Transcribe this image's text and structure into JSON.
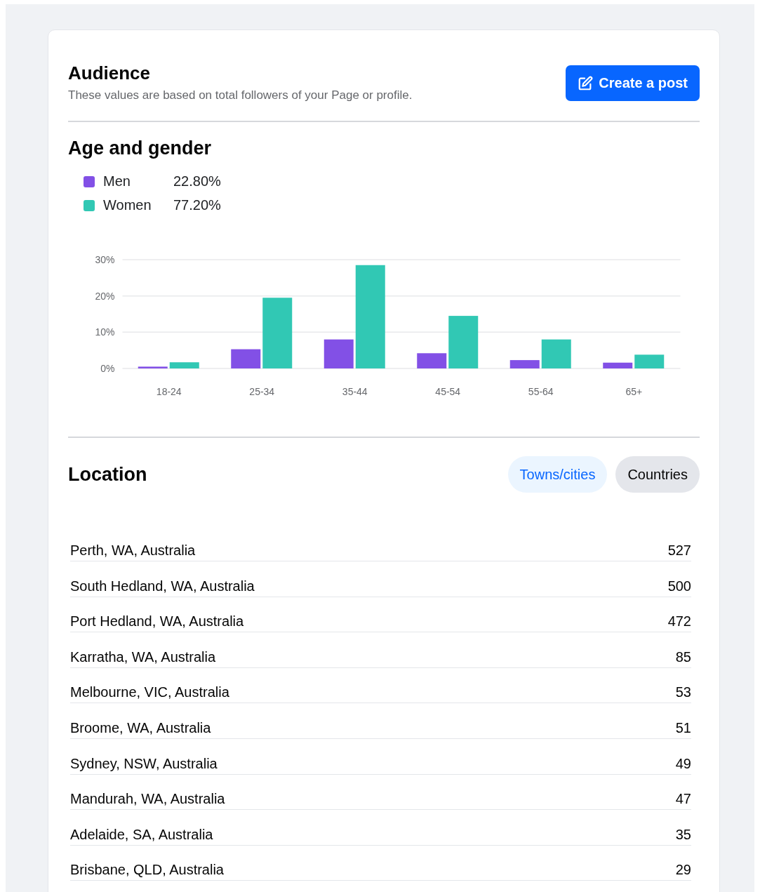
{
  "header": {
    "title": "Audience",
    "subtitle": "These values are based on total followers of your Page or profile.",
    "button": "Create a post"
  },
  "age_gender": {
    "title": "Age and gender",
    "legend_values": [
      "22.80%",
      "77.20%"
    ],
    "chart_data": {
      "type": "bar",
      "categories": [
        "18-24",
        "25-34",
        "35-44",
        "45-54",
        "55-64",
        "65+"
      ],
      "series": [
        {
          "name": "Men",
          "color": "#8250e6",
          "values": [
            0.5,
            5.3,
            8,
            4.2,
            2.3,
            1.6
          ]
        },
        {
          "name": "Women",
          "color": "#31c8b4",
          "values": [
            1.7,
            19.5,
            28.5,
            14.5,
            8,
            3.8
          ]
        }
      ],
      "ylim": [
        0,
        30
      ],
      "yticks": [
        {
          "value": 0,
          "label": "0%"
        },
        {
          "value": 10,
          "label": "10%"
        },
        {
          "value": 20,
          "label": "20%"
        },
        {
          "value": 30,
          "label": "30%"
        }
      ]
    }
  },
  "location": {
    "title": "Location",
    "tabs": [
      {
        "label": "Towns/cities",
        "selected": true
      },
      {
        "label": "Countries",
        "selected": false
      }
    ],
    "rows": [
      {
        "place": "Perth, WA, Australia",
        "count": "527"
      },
      {
        "place": "South Hedland, WA, Australia",
        "count": "500"
      },
      {
        "place": "Port Hedland, WA, Australia",
        "count": "472"
      },
      {
        "place": "Karratha, WA, Australia",
        "count": "85"
      },
      {
        "place": "Melbourne, VIC, Australia",
        "count": "53"
      },
      {
        "place": "Broome, WA, Australia",
        "count": "51"
      },
      {
        "place": "Sydney, NSW, Australia",
        "count": "49"
      },
      {
        "place": "Mandurah, WA, Australia",
        "count": "47"
      },
      {
        "place": "Adelaide, SA, Australia",
        "count": "35"
      },
      {
        "place": "Brisbane, QLD, Australia",
        "count": "29"
      }
    ]
  }
}
